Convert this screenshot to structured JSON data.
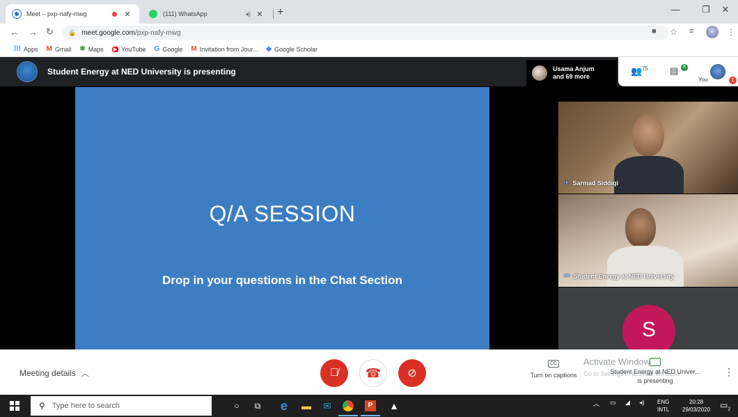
{
  "browser": {
    "tabs": [
      {
        "title": "Meet – pxp-nafy-mwg",
        "fav_color": "#1a73e8",
        "active": true
      },
      {
        "title": "(111) WhatsApp",
        "fav_color": "#25d366",
        "active": false
      }
    ],
    "url_host": "meet.google.com",
    "url_path": "/pxp-nafy-mwg",
    "bookmarks": [
      {
        "icon": "apps-grid-icon",
        "label": "Apps"
      },
      {
        "icon": "gmail-icon",
        "label": "Gmail"
      },
      {
        "icon": "maps-icon",
        "label": "Maps"
      },
      {
        "icon": "youtube-icon",
        "label": "YouTube"
      },
      {
        "icon": "google-icon",
        "label": "Google"
      },
      {
        "icon": "gmail-icon",
        "label": "Invitation from Jour..."
      },
      {
        "icon": "scholar-icon",
        "label": "Google Scholar"
      }
    ]
  },
  "meet": {
    "presenting_title": "Student Energy at NED University is presenting",
    "people_line1": "Usama Anjum",
    "people_line2": "and 69 more",
    "participant_count": "75",
    "chat_badge": "8",
    "you_label": "You",
    "alert_badge": "1",
    "slide": {
      "title": "Q/A SESSION",
      "subtitle": "Drop in your questions in the Chat Section",
      "bg": "#3d7dc2"
    },
    "tiles": [
      {
        "name": "Sarmad Siddiqi"
      },
      {
        "name": "Student Energy at NED University"
      },
      {
        "initial": "S",
        "color": "#c2185b"
      }
    ]
  },
  "controls": {
    "meeting_details": "Meeting details",
    "captions": "Turn on captions",
    "captions_badge": "CC",
    "activate_windows": "Activate Windows",
    "activate_windows_sub": "Go to Settings to activate Windows.",
    "presenting_line1": "Student Energy at NED Univer...",
    "presenting_line2": "is presenting"
  },
  "taskbar": {
    "search_placeholder": "Type here to search",
    "lang1": "ENG",
    "lang2": "INTL",
    "time": "20:28",
    "date": "29/03/2020",
    "notification_count": "2"
  }
}
